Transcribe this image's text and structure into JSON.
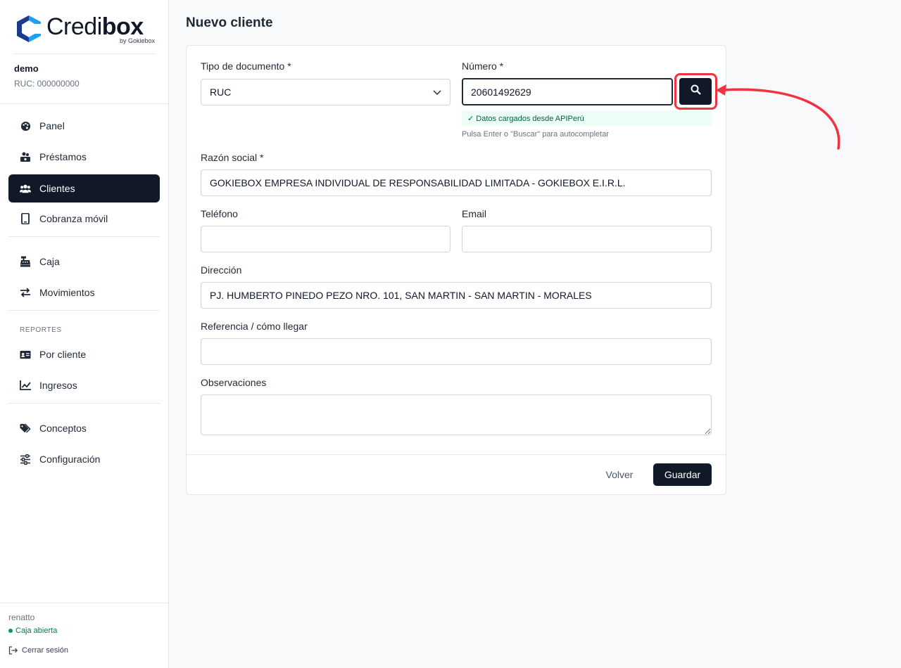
{
  "brand": {
    "name_light": "Credi",
    "name_bold": "box",
    "byline": "by Gokiebox",
    "colors": {
      "primary_dark": "#111827",
      "logo_blue": "#1da1f2",
      "logo_navy": "#1e3a8a",
      "accent_red": "#ef3340",
      "success_green": "#059669"
    }
  },
  "org": {
    "name": "demo",
    "ruc": "RUC: 000000000"
  },
  "sidebar": {
    "items": [
      {
        "label": "Panel",
        "icon": "palette-icon",
        "active": false
      },
      {
        "label": "Préstamos",
        "icon": "coins-icon",
        "active": false
      },
      {
        "label": "Clientes",
        "icon": "users-icon",
        "active": true
      },
      {
        "label": "Cobranza móvil",
        "icon": "mobile-icon",
        "active": false
      },
      {
        "label": "Caja",
        "icon": "cash-register-icon",
        "active": false
      },
      {
        "label": "Movimientos",
        "icon": "arrows-exchange-icon",
        "active": false
      },
      {
        "label": "Por cliente",
        "icon": "id-card-icon",
        "active": false
      },
      {
        "label": "Ingresos",
        "icon": "line-chart-icon",
        "active": false
      },
      {
        "label": "Conceptos",
        "icon": "tags-icon",
        "active": false
      },
      {
        "label": "Configuración",
        "icon": "sliders-icon",
        "active": false
      }
    ],
    "section_reportes": "REPORTES"
  },
  "footer": {
    "user": "renatto",
    "caja_status": "Caja abierta",
    "logout": "Cerrar sesión"
  },
  "page": {
    "title": "Nuevo cliente"
  },
  "form": {
    "tipo_documento": {
      "label": "Tipo de documento *",
      "value": "RUC"
    },
    "numero": {
      "label": "Número *",
      "value": "20601492629"
    },
    "success_message": "✓ Datos cargados desde APIPerú",
    "hint": "Pulsa Enter o \"Buscar\" para autocompletar",
    "razon_social": {
      "label": "Razón social *",
      "value": "GOKIEBOX EMPRESA INDIVIDUAL DE RESPONSABILIDAD LIMITADA - GOKIEBOX E.I.R.L."
    },
    "telefono": {
      "label": "Teléfono",
      "value": ""
    },
    "email": {
      "label": "Email",
      "value": ""
    },
    "direccion": {
      "label": "Dirección",
      "value": "PJ. HUMBERTO PINEDO PEZO NRO. 101, SAN MARTIN - SAN MARTIN - MORALES"
    },
    "referencia": {
      "label": "Referencia / cómo llegar",
      "value": ""
    },
    "observaciones": {
      "label": "Observaciones",
      "value": ""
    },
    "back_label": "Volver",
    "save_label": "Guardar"
  }
}
